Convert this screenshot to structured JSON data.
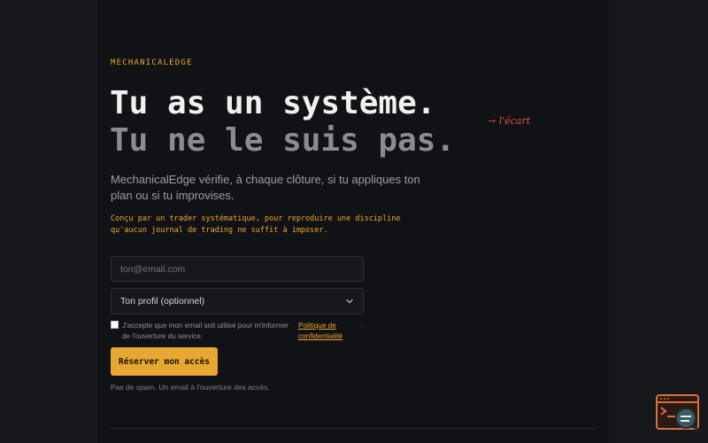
{
  "brand": "MECHANICALEDGE",
  "headline": {
    "line1": "Tu as un système.",
    "line2": "Tu ne le suis pas."
  },
  "annotation": "→ l'écart",
  "lead": "MechanicalEdge vérifie, à chaque clôture, si tu appliques ton plan ou si tu improvises.",
  "note": "Conçu par un trader systématique, pour reproduire une discipline qu'aucun journal de trading ne suffit à imposer.",
  "form": {
    "email_placeholder": "ton@email.com",
    "profile_select": "Ton profil (optionnel)",
    "consent_text": "J'accepte que mon email soit utilisé pour m'informer de l'ouverture du service.",
    "privacy_link": "Politique de confidentialité",
    "consent_trailing": ".",
    "submit_label": "Réserver mon accès",
    "footnote": "Pas de spam. Un email à l'ouverture des accès."
  },
  "colors": {
    "accent": "#e6a833",
    "annotation": "#d9573c",
    "background": "#111215"
  },
  "icons": [
    "chevron-down-icon",
    "terminal-search-icon"
  ]
}
